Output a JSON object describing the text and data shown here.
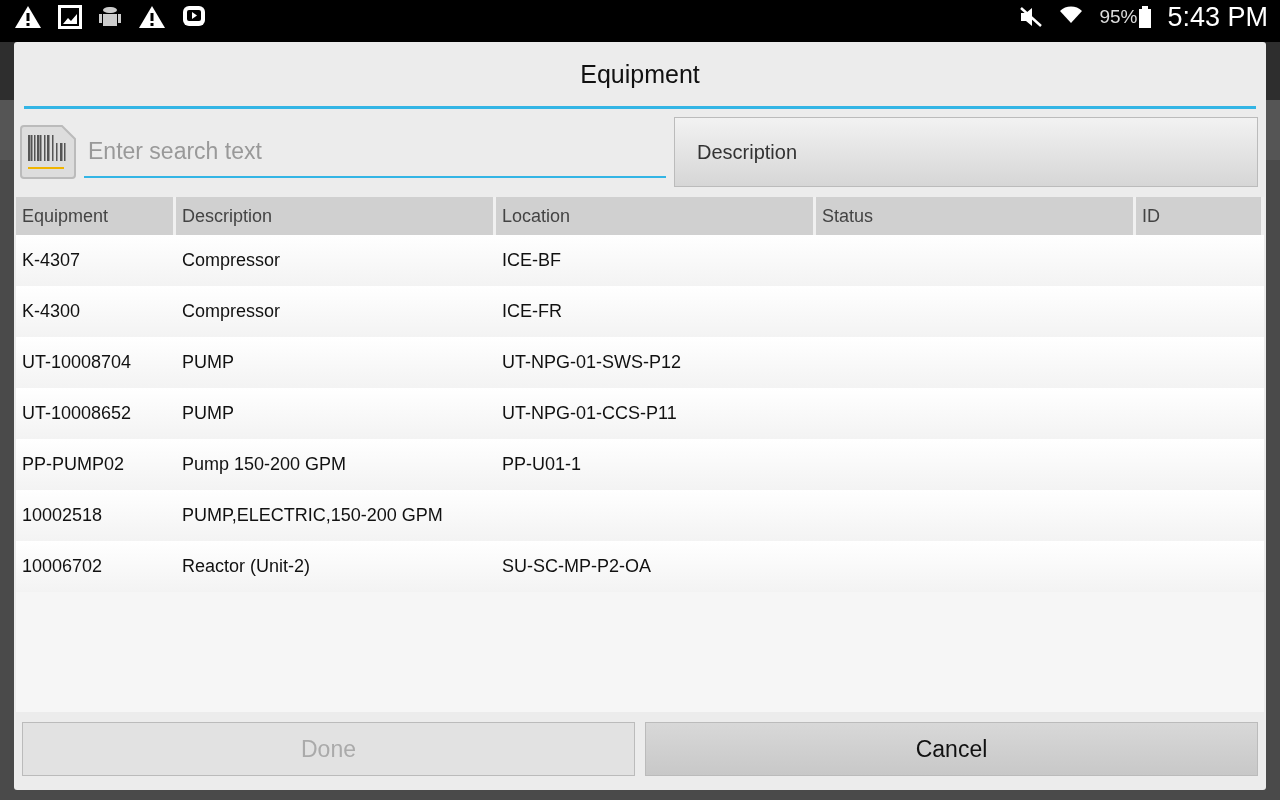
{
  "status_bar": {
    "battery": "95%",
    "time": "5:43 PM"
  },
  "dialog": {
    "title": "Equipment",
    "search": {
      "placeholder": "Enter search text"
    },
    "sort_button": {
      "label": "Description"
    },
    "table": {
      "columns": [
        "Equipment",
        "Description",
        "Location",
        "Status",
        "ID"
      ],
      "rows": [
        {
          "equipment": "K-4307",
          "description": "Compressor",
          "location": "ICE-BF"
        },
        {
          "equipment": "K-4300",
          "description": "Compressor",
          "location": "ICE-FR"
        },
        {
          "equipment": "UT-10008704",
          "description": "PUMP",
          "location": "UT-NPG-01-SWS-P12"
        },
        {
          "equipment": "UT-10008652",
          "description": "PUMP",
          "location": "UT-NPG-01-CCS-P11"
        },
        {
          "equipment": "PP-PUMP02",
          "description": "Pump 150-200 GPM",
          "location": "PP-U01-1"
        },
        {
          "equipment": "10002518",
          "description": "PUMP,ELECTRIC,150-200 GPM"
        },
        {
          "equipment": "10006702",
          "description": "Reactor (Unit-2)",
          "location": "SU-SC-MP-P2-OA"
        }
      ]
    },
    "buttons": [
      {
        "label": "Done",
        "disabled": true
      },
      {
        "label": "Cancel",
        "disabled": false
      }
    ]
  }
}
